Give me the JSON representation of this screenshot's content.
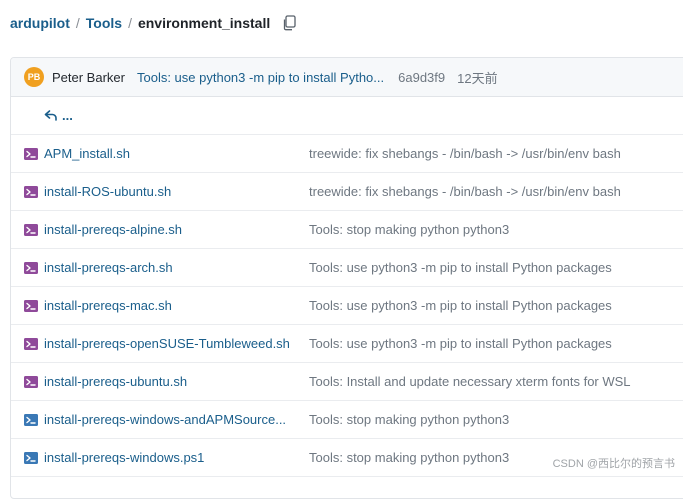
{
  "breadcrumb": {
    "repo": "ardupilot",
    "sep1": "/",
    "folder": "Tools",
    "sep2": "/",
    "current": "environment_install"
  },
  "latest_commit": {
    "avatar_initials": "PB",
    "author": "Peter Barker",
    "message": "Tools: use python3 -m pip to install Pytho...",
    "sha": "6a9d3f9",
    "time": "12天前"
  },
  "parent_dir": {
    "label": "..."
  },
  "files": [
    {
      "name": "APM_install.sh",
      "icon": "shell-script-icon",
      "commit": "treewide: fix shebangs - /bin/bash -> /usr/bin/env bash"
    },
    {
      "name": "install-ROS-ubuntu.sh",
      "icon": "shell-script-icon",
      "commit": "treewide: fix shebangs - /bin/bash -> /usr/bin/env bash"
    },
    {
      "name": "install-prereqs-alpine.sh",
      "icon": "shell-script-icon",
      "commit": "Tools: stop making python python3"
    },
    {
      "name": "install-prereqs-arch.sh",
      "icon": "shell-script-icon",
      "commit": "Tools: use python3 -m pip to install Python packages"
    },
    {
      "name": "install-prereqs-mac.sh",
      "icon": "shell-script-icon",
      "commit": "Tools: use python3 -m pip to install Python packages"
    },
    {
      "name": "install-prereqs-openSUSE-Tumbleweed.sh",
      "icon": "shell-script-icon",
      "commit": "Tools: use python3 -m pip to install Python packages"
    },
    {
      "name": "install-prereqs-ubuntu.sh",
      "icon": "shell-script-icon",
      "commit": "Tools: Install and update necessary xterm fonts for WSL"
    },
    {
      "name": "install-prereqs-windows-andAPMSource...",
      "icon": "powershell-icon",
      "commit": "Tools: stop making python python3"
    },
    {
      "name": "install-prereqs-windows.ps1",
      "icon": "powershell-icon",
      "commit": "Tools: stop making python python3"
    }
  ],
  "watermark": "CSDN @西比尔的预言书",
  "colors": {
    "link": "#1a5e8b",
    "muted": "#6e7781",
    "shell_icon": "#8f4a9a",
    "powershell_icon": "#3a78b5",
    "avatar": "#f0a020"
  }
}
